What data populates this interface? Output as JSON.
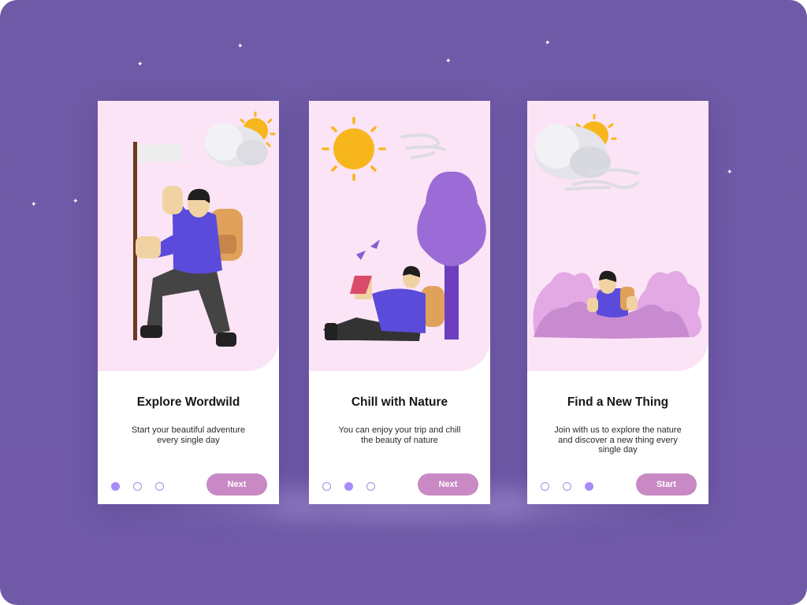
{
  "screens": [
    {
      "title": "Explore Wordwild",
      "description": "Start your beautiful adventure every single day",
      "button_label": "Next",
      "active_dot": 1,
      "illustration": "hiker-with-flag"
    },
    {
      "title": "Chill with Nature",
      "description": "You can enjoy your trip and chill the beauty of nature",
      "button_label": "Next",
      "active_dot": 2,
      "illustration": "reading-under-tree"
    },
    {
      "title": "Find a New Thing",
      "description": "Join with us to explore the nature and discover a new thing every single day",
      "button_label": "Start",
      "active_dot": 3,
      "illustration": "explorer-in-bushes"
    }
  ],
  "pagination_total": 3,
  "colors": {
    "background": "#705aa8",
    "card_top": "#fbe4f6",
    "button": "#c889c4",
    "dot_active": "#a78bfa",
    "dot_border": "#a98be0"
  }
}
